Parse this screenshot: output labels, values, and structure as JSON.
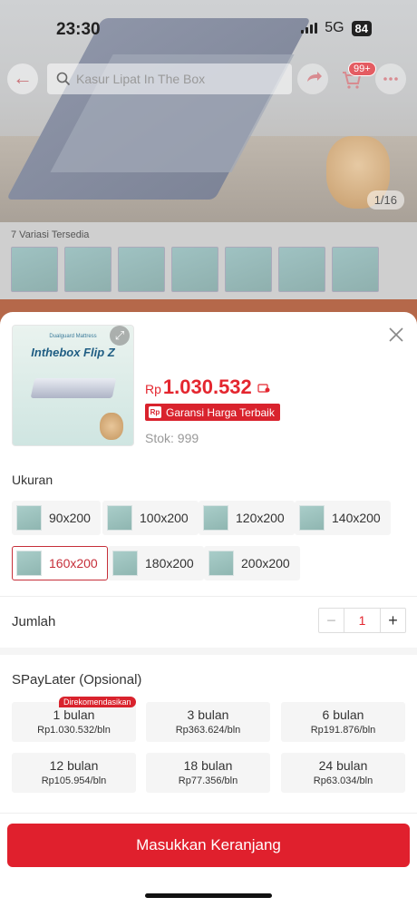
{
  "status_bar": {
    "time": "23:30",
    "network": "5G",
    "battery": "84"
  },
  "background_page": {
    "search_placeholder": "Kasur Lipat In The Box",
    "cart_badge": "99+",
    "image_counter": "1/16",
    "variants_label": "7 Variasi Tersedia"
  },
  "sheet": {
    "product_image": {
      "brand_sub": "Dualguard Mattress",
      "brand": "Inthebox Flip Z"
    },
    "price": {
      "currency": "Rp",
      "value": "1.030.532"
    },
    "guarantee": {
      "badge": "Rp",
      "label": "Garansi Harga Terbaik"
    },
    "stock": "Stok: 999",
    "size_label": "Ukuran",
    "sizes": [
      {
        "label": "90x200",
        "selected": false
      },
      {
        "label": "100x200",
        "selected": false
      },
      {
        "label": "120x200",
        "selected": false
      },
      {
        "label": "140x200",
        "selected": false
      },
      {
        "label": "160x200",
        "selected": true
      },
      {
        "label": "180x200",
        "selected": false
      },
      {
        "label": "200x200",
        "selected": false
      }
    ],
    "quantity": {
      "label": "Jumlah",
      "minus": "−",
      "value": "1",
      "plus": "+"
    },
    "spaylater": {
      "label": "SPayLater (Opsional)",
      "recommend_tag": "Direkomendasikan",
      "options": [
        {
          "months": "1 bulan",
          "amount": "Rp1.030.532/bln"
        },
        {
          "months": "3 bulan",
          "amount": "Rp363.624/bln"
        },
        {
          "months": "6 bulan",
          "amount": "Rp191.876/bln"
        },
        {
          "months": "12 bulan",
          "amount": "Rp105.954/bln"
        },
        {
          "months": "18 bulan",
          "amount": "Rp77.356/bln"
        },
        {
          "months": "24 bulan",
          "amount": "Rp63.034/bln"
        }
      ]
    },
    "cta": "Masukkan Keranjang"
  },
  "colors": {
    "accent": "#e0202d",
    "selected_border": "#c62f3a",
    "price": "#e4262f"
  }
}
